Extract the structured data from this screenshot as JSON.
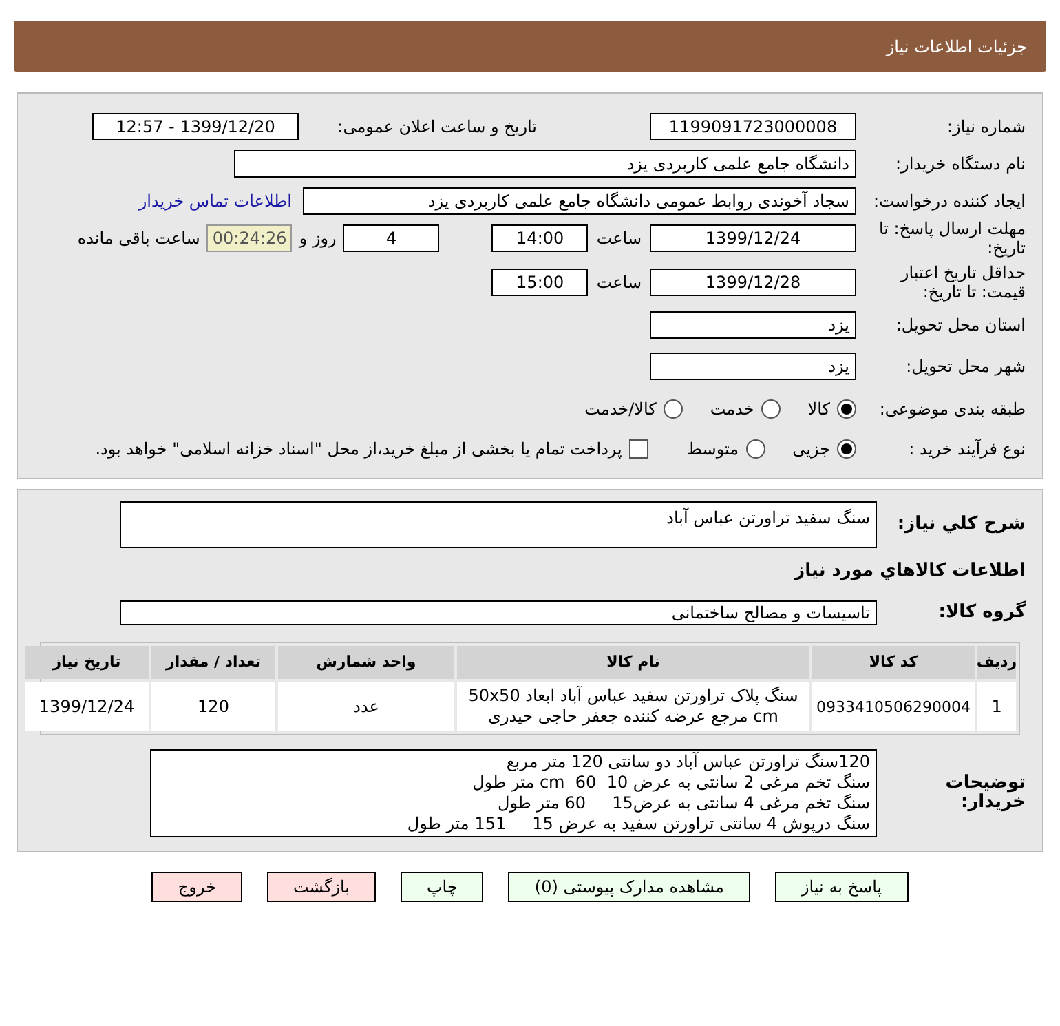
{
  "header": {
    "title": "جزئیات اطلاعات نیاز"
  },
  "details": {
    "need_number": {
      "label": "شماره نیاز:",
      "value": "1199091723000008"
    },
    "announce": {
      "label": "تاریخ و ساعت اعلان عمومی:",
      "value": "1399/12/20 - 12:57"
    },
    "buyer": {
      "label": "نام دستگاه خریدار:",
      "value": "دانشگاه جامع علمی کاربردی یزد"
    },
    "creator": {
      "label": "ایجاد کننده درخواست:",
      "value": "سجاد آخوندی روابط عمومی  دانشگاه جامع علمی کاربردی یزد",
      "link": "اطلاعات تماس خریدار"
    },
    "deadline": {
      "label": "مهلت ارسال پاسخ: تا تاریخ:",
      "date": "1399/12/24",
      "time_label": "ساعت",
      "time": "14:00",
      "days": "4",
      "days_label": "روز و",
      "remaining": "00:24:26",
      "remaining_label": "ساعت باقی مانده"
    },
    "validity": {
      "label": "حداقل تاریخ اعتبار قیمت: تا تاریخ:",
      "date": "1399/12/28",
      "time_label": "ساعت",
      "time": "15:00"
    },
    "province": {
      "label": "استان محل تحویل:",
      "value": "یزد"
    },
    "city": {
      "label": "شهر محل تحویل:",
      "value": "یزد"
    },
    "category": {
      "label": "طبقه بندی موضوعی:",
      "options": [
        {
          "label": "کالا",
          "selected": true
        },
        {
          "label": "خدمت",
          "selected": false
        },
        {
          "label": "کالا/خدمت",
          "selected": false
        }
      ]
    },
    "process": {
      "label": "نوع فرآیند خرید :",
      "options": [
        {
          "label": "جزیی",
          "selected": true
        },
        {
          "label": "متوسط",
          "selected": false
        }
      ],
      "treasury": {
        "label": "پرداخت تمام یا بخشی از مبلغ خرید،از محل \"اسناد خزانه اسلامی\" خواهد بود.",
        "checked": false
      }
    }
  },
  "needs": {
    "summary": {
      "label": "شرح کلي نياز:",
      "value": "سنگ سفید تراورتن عباس آباد"
    },
    "goods_title": "اطلاعات کالاهاي مورد نياز",
    "group": {
      "label": "گروه کالا:",
      "value": "تاسیسات و مصالح ساختمانی"
    },
    "table": {
      "columns": [
        "ردیف",
        "کد کالا",
        "نام کالا",
        "واحد شمارش",
        "تعداد / مقدار",
        "تاریخ نیاز"
      ],
      "rows": [
        [
          "1",
          "0933410506290004",
          "سنگ پلاک تراورتن سفید عباس آباد ابعاد 50x50 cm مرجع عرضه کننده جعفر حاجی حیدری",
          "عدد",
          "120",
          "1399/12/24"
        ]
      ]
    },
    "notes": {
      "label": "توضیحات خریدار:",
      "lines": [
        "120سنگ تراورتن عباس آباد دو سانتی 120 متر مربع",
        "سنگ تخم مرغی 2 سانتی به عرض 10  60  cm متر طول",
        "سنگ تخم مرغی 4 سانتی به عرض15     60 متر طول",
        "سنگ درپوش 4 سانتی تراورتن سفید به عرض 15     151 متر طول"
      ]
    }
  },
  "buttons": [
    {
      "label": "پاسخ به نیاز",
      "kind": "normal"
    },
    {
      "label": "مشاهده مدارک پیوستی (0)",
      "kind": "normal"
    },
    {
      "label": "چاپ",
      "kind": "normal"
    },
    {
      "label": "بازگشت",
      "kind": "danger"
    },
    {
      "label": "خروج",
      "kind": "danger"
    }
  ]
}
